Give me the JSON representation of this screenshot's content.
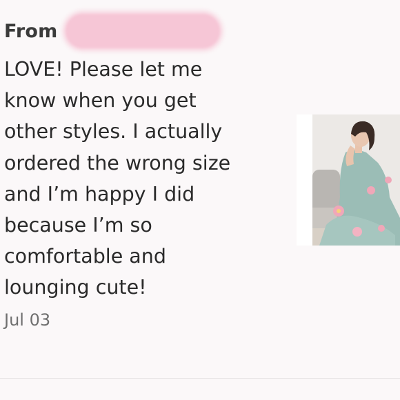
{
  "review": {
    "from_label": "From",
    "text": "LOVE! Please let me\nknow when you get\nother styles. I actually\nordered the wrong size\nand I’m happy I did\nbecause I’m so\ncomfortable and\nlounging cute!",
    "date": "Jul 03"
  },
  "product_image": {
    "description_icon": "product-photo",
    "colors": {
      "fabric": "#9bbdb6",
      "flower": "#f0a7b8",
      "background": "#e9e6e3"
    }
  },
  "colors": {
    "background": "#fbf8f9",
    "redaction": "#f6c6d6",
    "text": "#2a2a2a",
    "muted": "#6f6f6f"
  }
}
